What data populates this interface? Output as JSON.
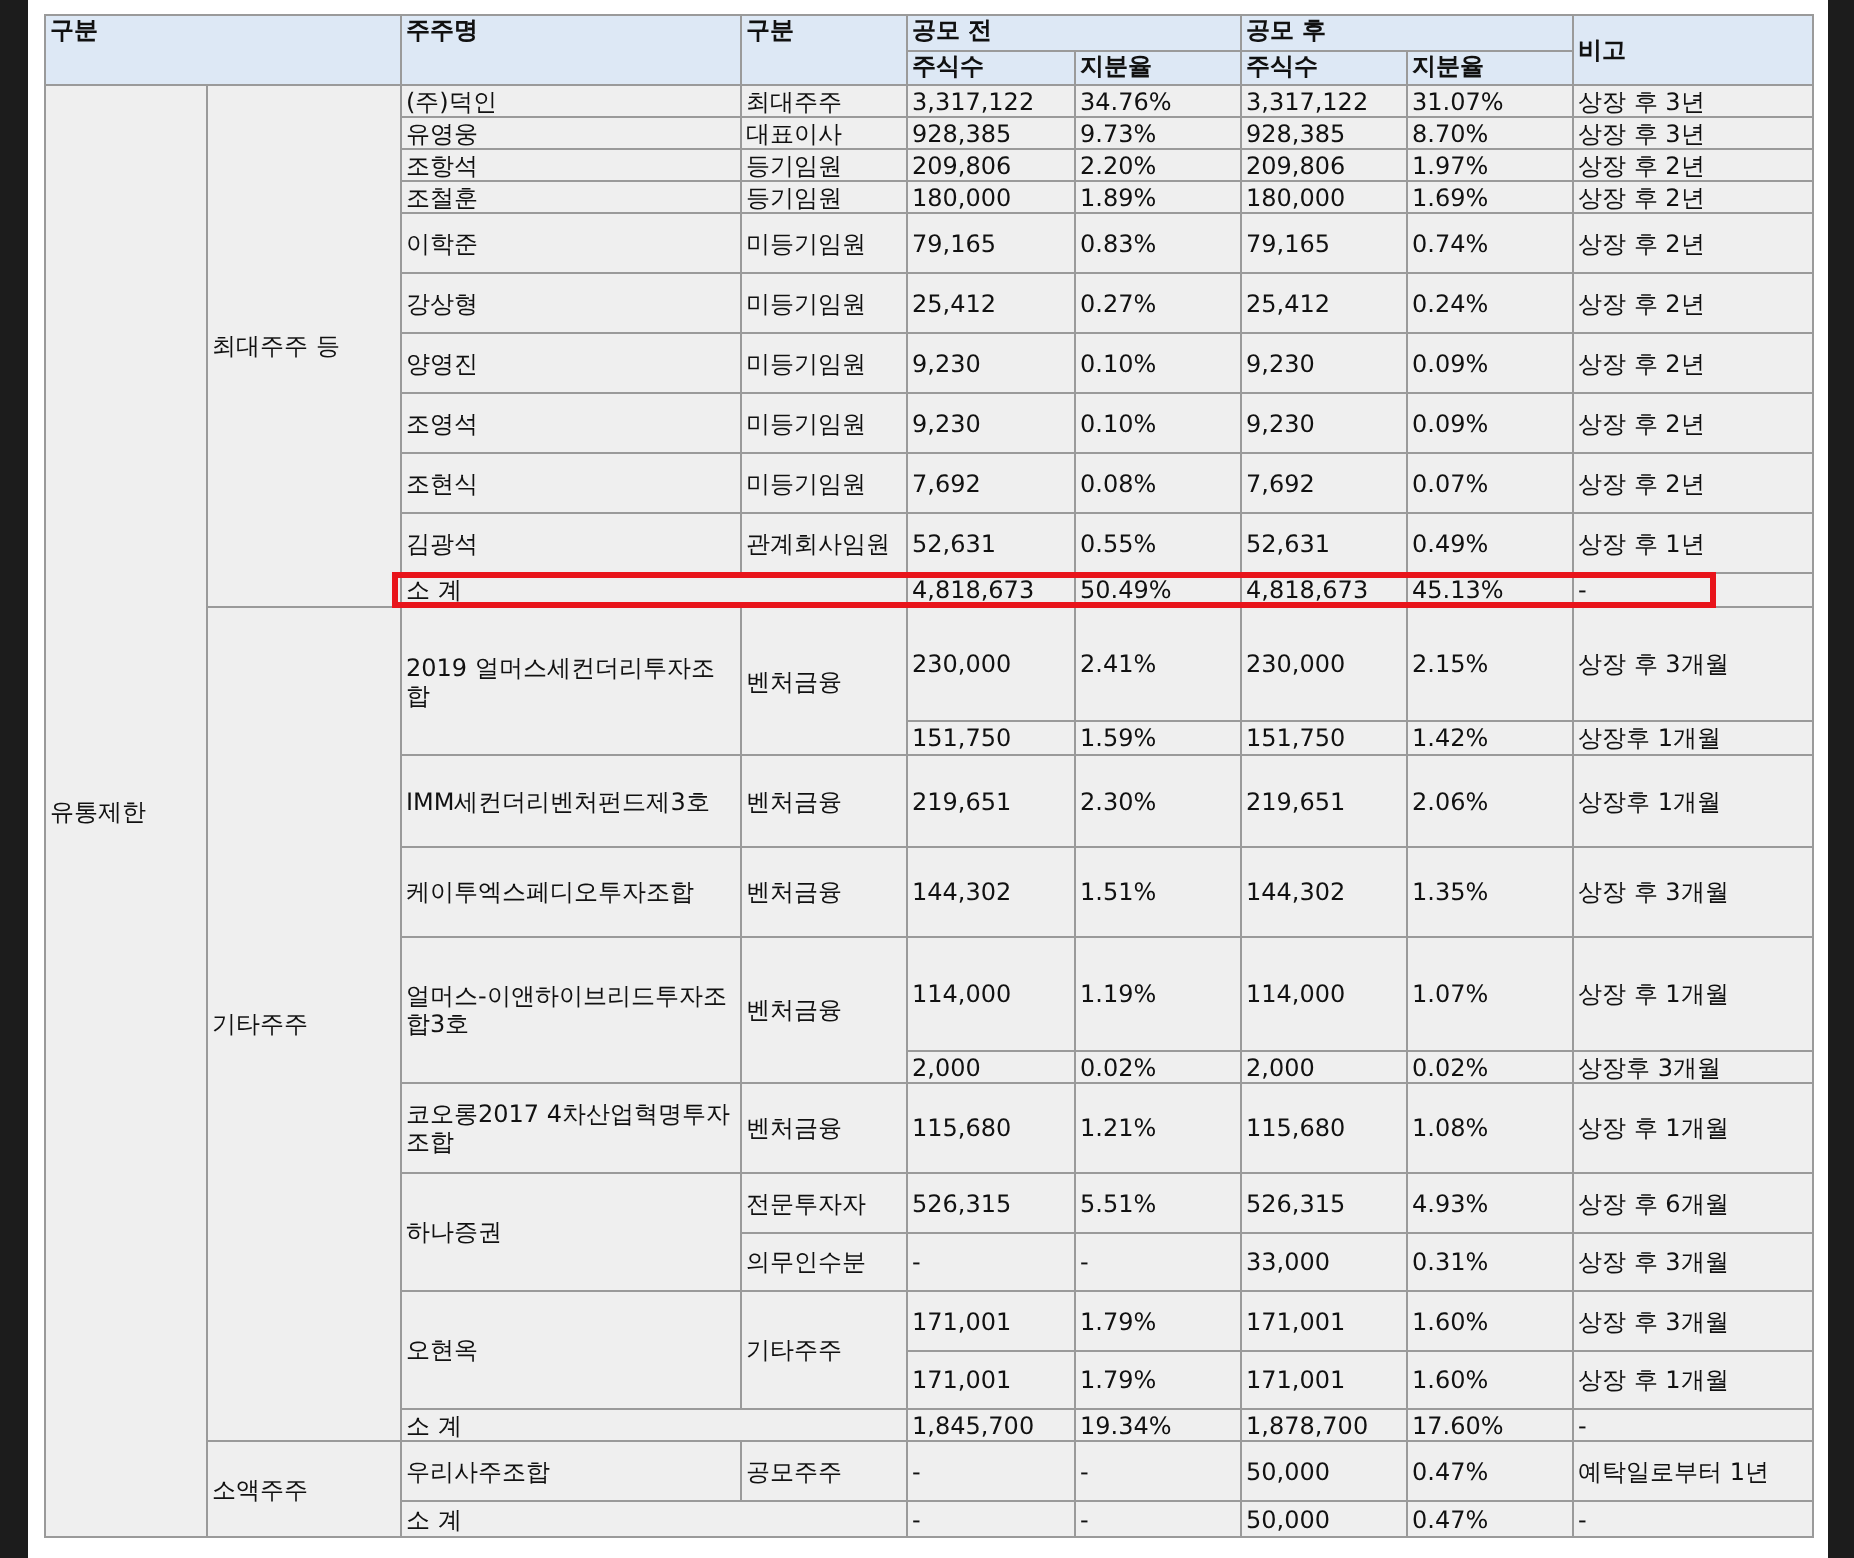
{
  "header": {
    "category": "구분",
    "name": "주주명",
    "type": "구분",
    "before": "공모 전",
    "after": "공모 후",
    "remark": "비고",
    "shares": [
      "주식수",
      "주식수"
    ],
    "ratio": [
      "지분율",
      "지분율"
    ]
  },
  "groups": [
    {
      "label": "유통제한",
      "subgroups": [
        {
          "label": "최대주주 등",
          "shareholders": [
            {
              "name": "(주)덕인",
              "entries": [
                {
                  "type": "최대주주",
                  "before_shares": "3,317,122",
                  "before_ratio": "34.76%",
                  "after_shares": "3,317,122",
                  "after_ratio": "31.07%",
                  "remark": "상장 후 3년"
                }
              ]
            },
            {
              "name": "유영웅",
              "entries": [
                {
                  "type": "대표이사",
                  "before_shares": "928,385",
                  "before_ratio": "9.73%",
                  "after_shares": "928,385",
                  "after_ratio": "8.70%",
                  "remark": "상장 후 3년"
                }
              ]
            },
            {
              "name": "조항석",
              "entries": [
                {
                  "type": "등기임원",
                  "before_shares": "209,806",
                  "before_ratio": "2.20%",
                  "after_shares": "209,806",
                  "after_ratio": "1.97%",
                  "remark": "상장 후 2년"
                }
              ]
            },
            {
              "name": "조철훈",
              "entries": [
                {
                  "type": "등기임원",
                  "before_shares": "180,000",
                  "before_ratio": "1.89%",
                  "after_shares": "180,000",
                  "after_ratio": "1.69%",
                  "remark": "상장 후 2년"
                }
              ]
            },
            {
              "name": "이학준",
              "entries": [
                {
                  "type": "미등기임원",
                  "before_shares": "79,165",
                  "before_ratio": "0.83%",
                  "after_shares": "79,165",
                  "after_ratio": "0.74%",
                  "remark": "상장 후 2년"
                }
              ]
            },
            {
              "name": "강상형",
              "entries": [
                {
                  "type": "미등기임원",
                  "before_shares": "25,412",
                  "before_ratio": "0.27%",
                  "after_shares": "25,412",
                  "after_ratio": "0.24%",
                  "remark": "상장 후 2년"
                }
              ]
            },
            {
              "name": "양영진",
              "entries": [
                {
                  "type": "미등기임원",
                  "before_shares": "9,230",
                  "before_ratio": "0.10%",
                  "after_shares": "9,230",
                  "after_ratio": "0.09%",
                  "remark": "상장 후 2년"
                }
              ]
            },
            {
              "name": "조영석",
              "entries": [
                {
                  "type": "미등기임원",
                  "before_shares": "9,230",
                  "before_ratio": "0.10%",
                  "after_shares": "9,230",
                  "after_ratio": "0.09%",
                  "remark": "상장 후 2년"
                }
              ]
            },
            {
              "name": "조현식",
              "entries": [
                {
                  "type": "미등기임원",
                  "before_shares": "7,692",
                  "before_ratio": "0.08%",
                  "after_shares": "7,692",
                  "after_ratio": "0.07%",
                  "remark": "상장 후 2년"
                }
              ]
            },
            {
              "name": "김광석",
              "entries": [
                {
                  "type": "관계회사임원",
                  "before_shares": "52,631",
                  "before_ratio": "0.55%",
                  "after_shares": "52,631",
                  "after_ratio": "0.49%",
                  "remark": "상장 후 1년"
                }
              ]
            }
          ],
          "subtotal": {
            "label": "소 계",
            "before_shares": "4,818,673",
            "before_ratio": "50.49%",
            "after_shares": "4,818,673",
            "after_ratio": "45.13%",
            "remark": "-",
            "highlighted": true
          }
        },
        {
          "label": "기타주주",
          "shareholders": [
            {
              "name": "2019 얼머스세컨더리투자조합",
              "type": "벤처금융",
              "entries": [
                {
                  "before_shares": "230,000",
                  "before_ratio": "2.41%",
                  "after_shares": "230,000",
                  "after_ratio": "2.15%",
                  "remark": "상장 후 3개월"
                },
                {
                  "before_shares": "151,750",
                  "before_ratio": "1.59%",
                  "after_shares": "151,750",
                  "after_ratio": "1.42%",
                  "remark": "상장후 1개월"
                }
              ]
            },
            {
              "name": "IMM세컨더리벤처펀드제3호",
              "entries": [
                {
                  "type": "벤처금융",
                  "before_shares": "219,651",
                  "before_ratio": "2.30%",
                  "after_shares": "219,651",
                  "after_ratio": "2.06%",
                  "remark": "상장후 1개월"
                }
              ]
            },
            {
              "name": "케이투엑스페디오투자조합",
              "entries": [
                {
                  "type": "벤처금융",
                  "before_shares": "144,302",
                  "before_ratio": "1.51%",
                  "after_shares": "144,302",
                  "after_ratio": "1.35%",
                  "remark": "상장 후 3개월"
                }
              ]
            },
            {
              "name": "얼머스-이앤하이브리드투자조합3호",
              "type": "벤처금융",
              "entries": [
                {
                  "before_shares": "114,000",
                  "before_ratio": "1.19%",
                  "after_shares": "114,000",
                  "after_ratio": "1.07%",
                  "remark": "상장 후 1개월"
                },
                {
                  "before_shares": "2,000",
                  "before_ratio": "0.02%",
                  "after_shares": "2,000",
                  "after_ratio": "0.02%",
                  "remark": "상장후 3개월"
                }
              ]
            },
            {
              "name": "코오롱2017 4차산업혁명투자조합",
              "entries": [
                {
                  "type": "벤처금융",
                  "before_shares": "115,680",
                  "before_ratio": "1.21%",
                  "after_shares": "115,680",
                  "after_ratio": "1.08%",
                  "remark": "상장 후 1개월"
                }
              ]
            },
            {
              "name": "하나증권",
              "entries": [
                {
                  "type": "전문투자자",
                  "before_shares": "526,315",
                  "before_ratio": "5.51%",
                  "after_shares": "526,315",
                  "after_ratio": "4.93%",
                  "remark": "상장 후 6개월"
                },
                {
                  "type": "의무인수분",
                  "before_shares": "-",
                  "before_ratio": "-",
                  "after_shares": "33,000",
                  "after_ratio": "0.31%",
                  "remark": "상장 후 3개월"
                }
              ]
            },
            {
              "name": "오현옥",
              "type": "기타주주",
              "entries": [
                {
                  "before_shares": "171,001",
                  "before_ratio": "1.79%",
                  "after_shares": "171,001",
                  "after_ratio": "1.60%",
                  "remark": "상장 후 3개월"
                },
                {
                  "before_shares": "171,001",
                  "before_ratio": "1.79%",
                  "after_shares": "171,001",
                  "after_ratio": "1.60%",
                  "remark": "상장 후 1개월"
                }
              ]
            }
          ],
          "subtotal": {
            "label": "소 계",
            "before_shares": "1,845,700",
            "before_ratio": "19.34%",
            "after_shares": "1,878,700",
            "after_ratio": "17.60%",
            "remark": "-",
            "highlighted": false
          }
        },
        {
          "label": "소액주주",
          "shareholders": [
            {
              "name": "우리사주조합",
              "entries": [
                {
                  "type": "공모주주",
                  "before_shares": "-",
                  "before_ratio": "-",
                  "after_shares": "50,000",
                  "after_ratio": "0.47%",
                  "remark": "예탁일로부터 1년"
                }
              ]
            }
          ],
          "subtotal": {
            "label": "소 계",
            "before_shares": "-",
            "before_ratio": "-",
            "after_shares": "50,000",
            "after_ratio": "0.47%",
            "remark": "-",
            "highlighted": false
          }
        }
      ]
    }
  ]
}
